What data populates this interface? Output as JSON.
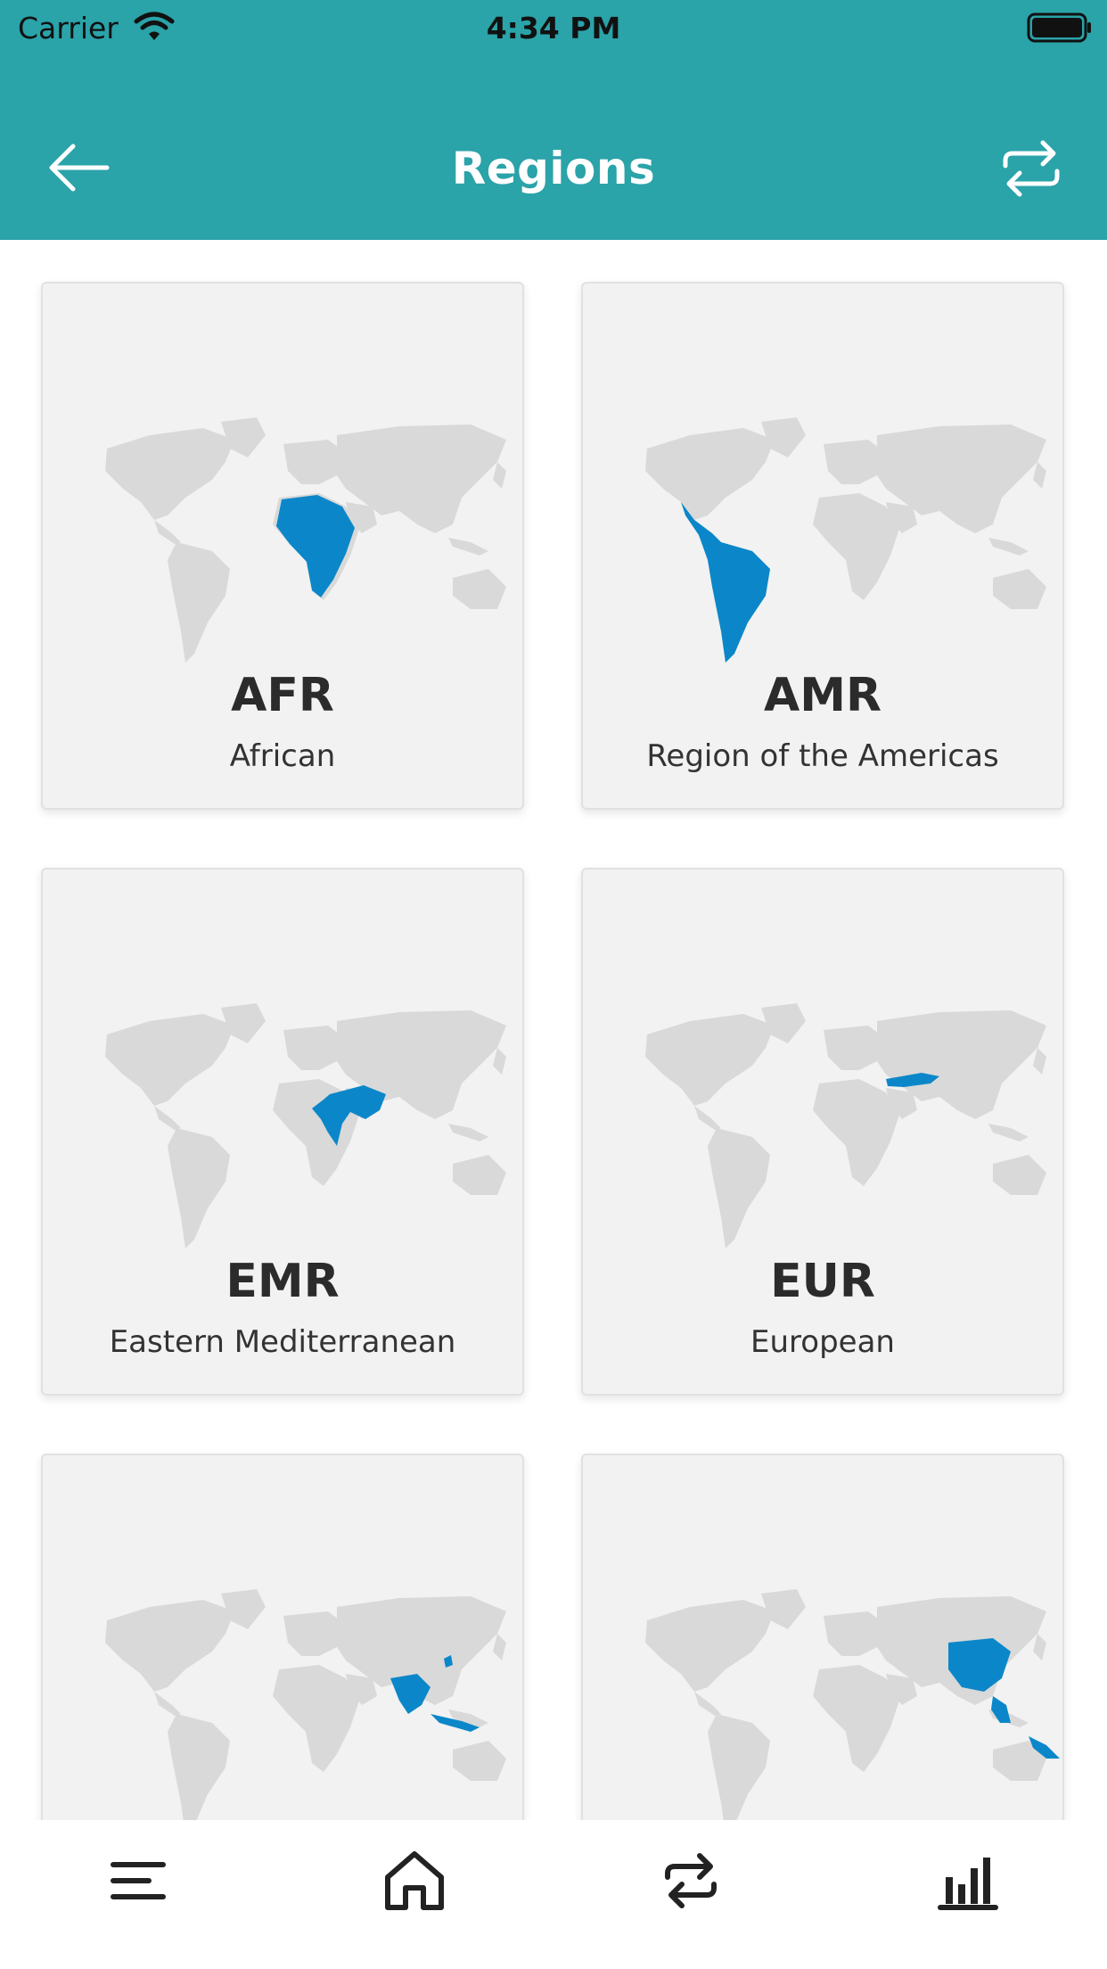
{
  "status_bar": {
    "carrier": "Carrier",
    "time": "4:34 PM",
    "icons": [
      "wifi-icon",
      "battery-icon"
    ]
  },
  "header": {
    "title": "Regions",
    "back_icon": "arrow-left-icon",
    "action_icon": "swap-arrows-icon"
  },
  "colors": {
    "header_bg": "#2aa3a9",
    "highlight_blue": "#0b87c9",
    "land_gray": "#d9d9d9",
    "card_bg": "#f2f2f2"
  },
  "regions": [
    {
      "code": "AFR",
      "name": "African",
      "highlight": "africa"
    },
    {
      "code": "AMR",
      "name": "Region of the Americas",
      "highlight": "latin-america"
    },
    {
      "code": "EMR",
      "name": "Eastern Mediterranean",
      "highlight": "middle-east"
    },
    {
      "code": "EUR",
      "name": "European",
      "highlight": "central-asia"
    },
    {
      "code": "",
      "name": "",
      "highlight": "south-east-asia"
    },
    {
      "code": "",
      "name": "",
      "highlight": "western-pacific"
    }
  ],
  "tabbar": {
    "items": [
      "menu-icon",
      "home-icon",
      "swap-arrows-icon",
      "bar-chart-icon"
    ]
  }
}
